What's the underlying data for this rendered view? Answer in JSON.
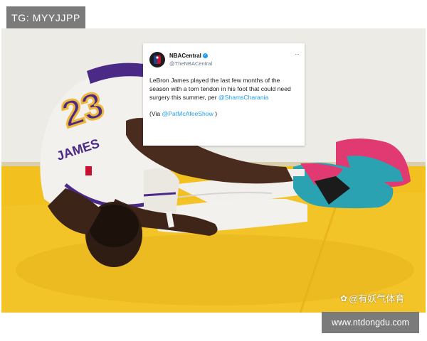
{
  "top_badge": {
    "label": "TG: MYYJJPP"
  },
  "jersey": {
    "number": "23",
    "name": "JAMES"
  },
  "tweet": {
    "name": "NBACentral",
    "handle": "@TheNBACentral",
    "body_text": "LeBron James played the last few months of the season with a torn tendon in his foot that could need surgery this summer, per",
    "mention": "@ShamsCharania",
    "via_prefix": "(Via",
    "via_handle": "@PatMcAfeeShow",
    "via_suffix": ")",
    "more_icon": "ellipsis-icon"
  },
  "watermark": {
    "text": "@有妖气体育",
    "icon": "paw-icon"
  },
  "url_badge": {
    "label": "www.ntdongdu.com"
  },
  "colors": {
    "court": "#f2c01f",
    "jersey_white": "#f3f1ee",
    "purple": "#4b2a87",
    "gold": "#f0b83b",
    "shoe_pink": "#e13a73",
    "shoe_teal": "#2aa2b2",
    "badge_gray": "#7b7b7b",
    "link_blue": "#1d9bf0"
  }
}
